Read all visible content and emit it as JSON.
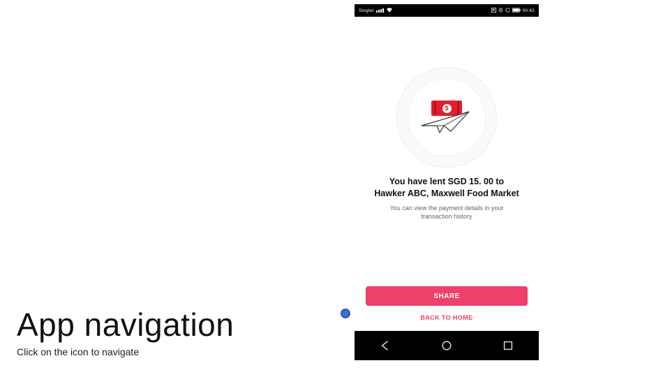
{
  "slide": {
    "title": "App navigation",
    "subtitle": "Click on the icon to navigate"
  },
  "statusbar": {
    "carrier": "Singtel",
    "time": "00:42"
  },
  "confirmation": {
    "headline_line1": "You have lent SGD 15. 00 to",
    "headline_line2": "Hawker ABC, Maxwell Food Market",
    "subline_line1": "You can view the payment details in your",
    "subline_line2": "transaction history",
    "money_symbol": "$"
  },
  "buttons": {
    "share": "SHARE",
    "back_home": "BACK TO HOME"
  },
  "icons": {
    "signal": "signal-icon",
    "wifi": "wifi-icon",
    "alarm": "alarm-icon",
    "nfc": "nfc-icon",
    "battery": "battery-icon",
    "back": "back-icon",
    "home": "home-icon",
    "recent": "recent-icon",
    "plane": "paper-plane-icon",
    "money": "money-icon"
  }
}
